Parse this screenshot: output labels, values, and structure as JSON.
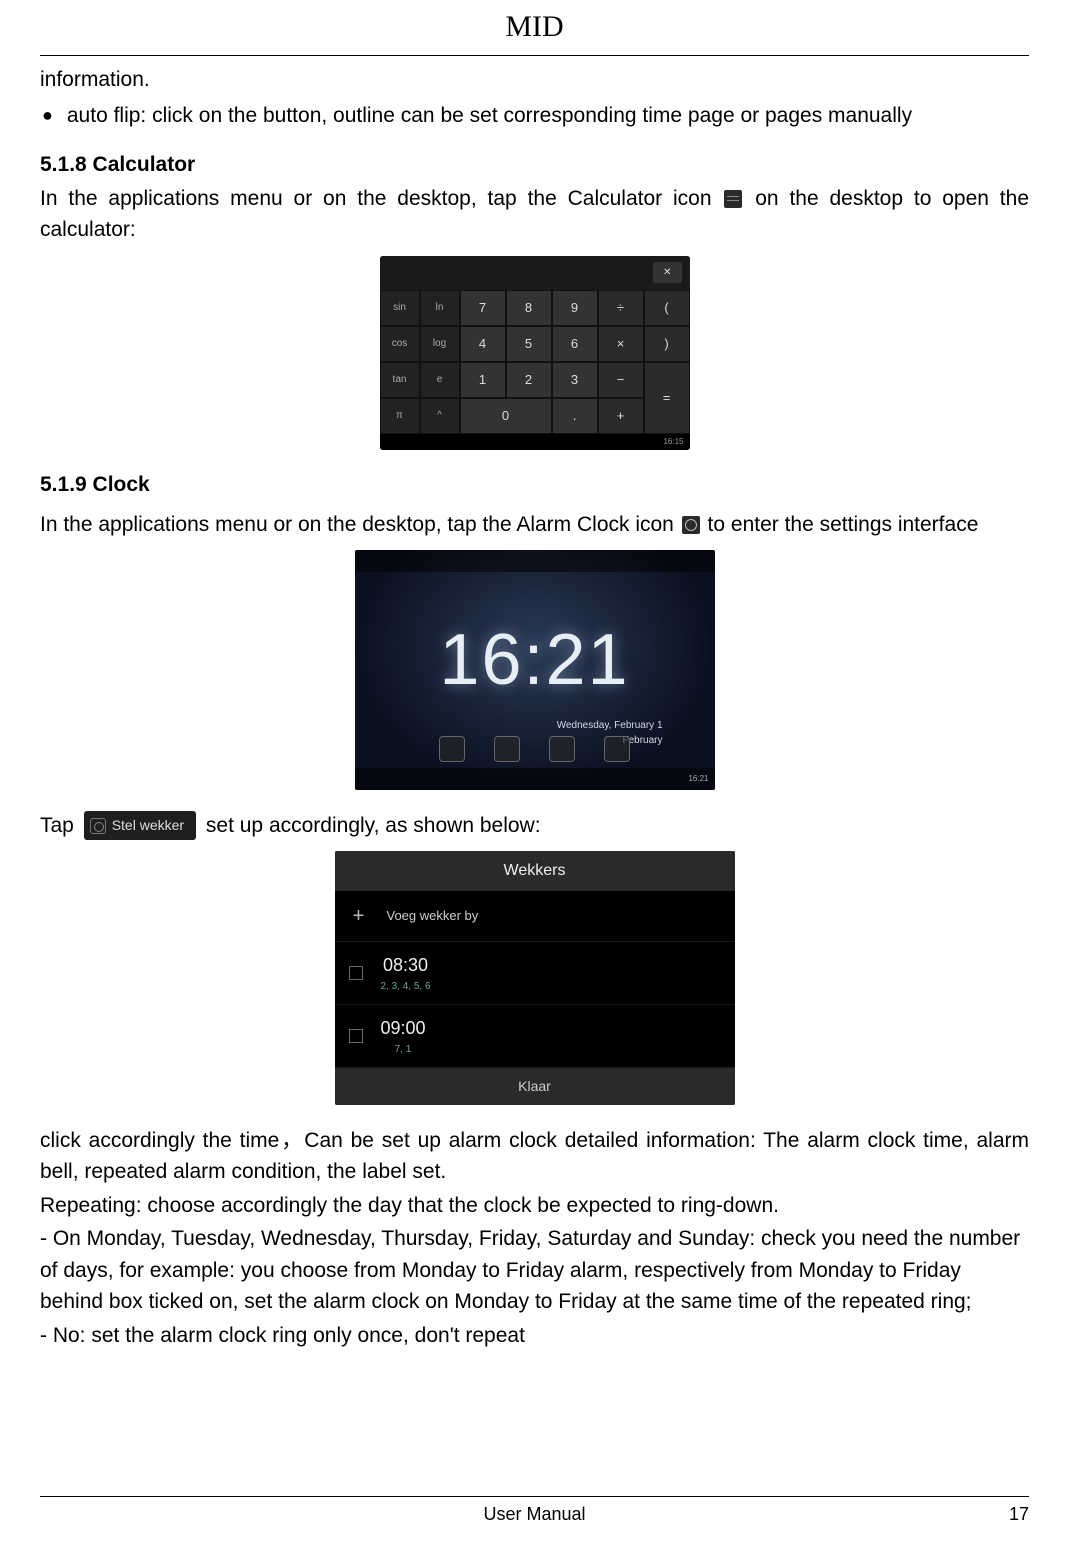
{
  "header": {
    "title": "MID"
  },
  "intro_tail": "information.",
  "bullet": "auto flip: click on the button, outline can be set corresponding time page or pages manually",
  "calculator": {
    "heading": "5.1.8 Calculator",
    "body_before": "In the applications menu or on the desktop, tap the Calculator icon ",
    "body_after": " on the desktop to open the calculator:",
    "keys_fn": [
      [
        "sin",
        "ln"
      ],
      [
        "cos",
        "log"
      ],
      [
        "tan",
        "e"
      ],
      [
        "π",
        "^"
      ]
    ],
    "keys_num": [
      [
        "7",
        "8",
        "9",
        "÷",
        "("
      ],
      [
        "4",
        "5",
        "6",
        "×",
        ")"
      ],
      [
        "1",
        "2",
        "3",
        "−",
        "="
      ],
      [
        "0",
        ".",
        "",
        "+",
        ""
      ]
    ],
    "status_time": "16:15"
  },
  "clock": {
    "heading": "5.1.9 Clock",
    "body_before": "In the applications menu or on the desktop, tap the Alarm Clock icon ",
    "body_after": " to enter the settings interface",
    "time": "16:21",
    "date_line1": "Wednesday, February 1",
    "date_line2": "February",
    "status_time": "16:21"
  },
  "tap_line_before": "Tap ",
  "stel_button_label": "Stel wekker",
  "tap_line_after": " set up accordingly, as shown below:",
  "wekkers": {
    "title": "Wekkers",
    "add_label": "Voeg wekker by",
    "alarms": [
      {
        "time": "08:30",
        "days": "2, 3, 4, 5, 6"
      },
      {
        "time": "09:00",
        "days": "7, 1"
      }
    ],
    "footer": "Klaar"
  },
  "paragraphs": {
    "p1": "click accordingly the time，Can be set up alarm clock detailed information: The alarm clock time, alarm bell, repeated alarm condition, the label set.",
    "p2": "Repeating: choose accordingly the day that the clock be expected to ring-down.",
    "p3": "- On Monday, Tuesday, Wednesday, Thursday, Friday, Saturday and Sunday: check you need the number of days, for example: you choose from Monday to Friday alarm, respectively from Monday to Friday behind box ticked on, set the alarm clock on Monday to Friday at the same time of the repeated ring;",
    "p4": "- No: set the alarm clock ring only once, don't repeat"
  },
  "footer": {
    "label": "User Manual",
    "page": "17"
  }
}
